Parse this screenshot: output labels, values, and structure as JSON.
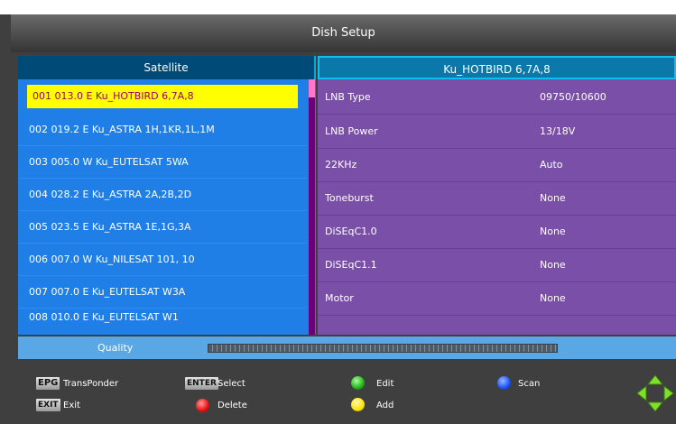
{
  "title": "Dish Setup",
  "satellite_panel": {
    "header": "Satellite",
    "items": [
      "001 013.0 E  Ku_HOTBIRD 6,7A,8",
      "002 019.2 E  Ku_ASTRA 1H,1KR,1L,1M",
      "003 005.0 W  Ku_EUTELSAT 5WA",
      "004 028.2 E  Ku_ASTRA 2A,2B,2D",
      "005 023.5 E  Ku_ASTRA 1E,1G,3A",
      "006 007.0 W  Ku_NILESAT 101, 10",
      "007 007.0 E  Ku_EUTELSAT W3A",
      "008 010.0 E  Ku_EUTELSAT W1"
    ],
    "selected_index": 0
  },
  "lnb_panel": {
    "header": "Ku_HOTBIRD 6,7A,8",
    "rows": [
      {
        "label": "LNB Type",
        "value": "09750/10600"
      },
      {
        "label": "LNB Power",
        "value": "13/18V"
      },
      {
        "label": "22KHz",
        "value": "Auto"
      },
      {
        "label": "Toneburst",
        "value": "None"
      },
      {
        "label": "DiSEqC1.0",
        "value": "None"
      },
      {
        "label": "DiSEqC1.1",
        "value": "None"
      },
      {
        "label": "Motor",
        "value": "None"
      }
    ]
  },
  "quality": {
    "label": "Quality",
    "level": 0
  },
  "legend": {
    "epg_key": "EPG",
    "epg_text": "TransPonder",
    "exit_key": "EXIT",
    "exit_text": "Exit",
    "enter_key": "ENTER",
    "enter_text": "Select",
    "delete_text": "Delete",
    "edit_text": "Edit",
    "add_text": "Add",
    "scan_text": "Scan"
  },
  "colors": {
    "satellite_list": "#1f7fe6",
    "selection": "#ffff00",
    "lnb_panel": "#7a4fa8",
    "quality_bar": "#5aa7e6"
  },
  "icons": {
    "edit": "green-dot-icon",
    "delete": "red-dot-icon",
    "add": "yellow-dot-icon",
    "scan": "blue-dot-icon",
    "navigation": "direction-arrows-icon"
  }
}
